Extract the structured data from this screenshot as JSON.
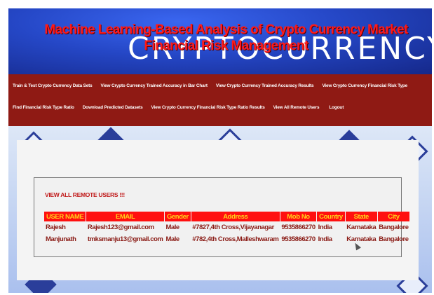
{
  "header": {
    "title": "Machine Learning-Based Analysis of Crypto Currency Market Financial Risk Management",
    "background_word": "CRYPTOCURRENCY"
  },
  "nav": {
    "row1": [
      "Train & Test Crypto Currency Data Sets",
      "View Crypto Currency Trained Accuracy in Bar Chart",
      "View Crypto Currency Trained Accuracy Results",
      "View Crypto Currency Financial Risk Type"
    ],
    "row2": [
      "Find Financial Risk Type Ratio",
      "Download Predicted Datasets",
      "View Crypto Currency Financial Risk Type Ratio Results",
      "View All Remote Users",
      "Logout"
    ]
  },
  "section": {
    "heading": "VIEW ALL REMOTE USERS !!!"
  },
  "table": {
    "headers": [
      "USER NAME",
      "EMAIL",
      "Gender",
      "Address",
      "Mob No",
      "Country",
      "State",
      "City"
    ],
    "rows": [
      [
        "Rajesh",
        "Rajesh123@gmail.com",
        "Male",
        "#7827,4th Cross,Vijayanagar",
        "9535866270",
        "India",
        "Karnataka",
        "Bangalore"
      ],
      [
        "Manjunath",
        "tmksmanju13@gmail.com",
        "Male",
        "#782,4th Cross,Malleshwaram",
        "9535866270",
        "India",
        "Karnataka",
        "Bangalore"
      ]
    ]
  },
  "colors": {
    "nav_bg": "#8f1a14",
    "title_red": "#ff1a1a",
    "th_bg": "#ff1010",
    "th_text": "#ffd21a",
    "td_text": "#8a1a14"
  }
}
